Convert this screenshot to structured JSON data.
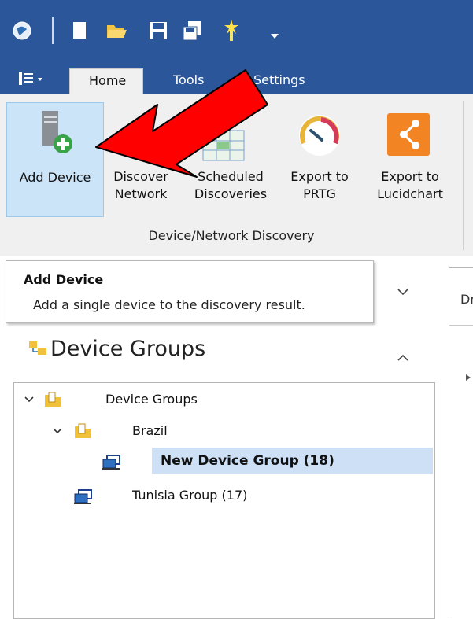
{
  "quick_access": {
    "icons": [
      "app-globe-icon",
      "new-file-icon",
      "open-folder-icon",
      "save-icon",
      "save-all-icon",
      "wizard-icon",
      "customize-dropdown-icon"
    ]
  },
  "tabs": [
    {
      "label": "Home",
      "active": true
    },
    {
      "label": "Tools",
      "active": false
    },
    {
      "label": "Settings",
      "active": false
    }
  ],
  "ribbon": {
    "buttons": [
      {
        "line1": "Add Device",
        "line2": ""
      },
      {
        "line1": "Discover",
        "line2": "Network"
      },
      {
        "line1": "Scheduled",
        "line2": "Discoveries"
      },
      {
        "line1": "Export to",
        "line2": "PRTG"
      },
      {
        "line1": "Export to",
        "line2": "Lucidchart"
      }
    ],
    "group_caption": "Device/Network Discovery"
  },
  "tooltip": {
    "title": "Add Device",
    "description": "Add a single device to the discovery result."
  },
  "right_panel": {
    "header_fragment": "Dr"
  },
  "device_groups": {
    "title": "Device Groups",
    "tree": [
      {
        "label": "Device Groups",
        "expanded": true
      },
      {
        "label": "Brazil",
        "expanded": true
      },
      {
        "label": "New Device Group (18)",
        "selected": true
      },
      {
        "label": "Tunisia Group (17)"
      }
    ]
  },
  "colors": {
    "title_bar": "#2b579a",
    "ribbon_bg": "#f0f0f0",
    "selected_button": "#cce4f7",
    "selected_row": "#cde0f5",
    "annotation_arrow": "#ff0000"
  }
}
